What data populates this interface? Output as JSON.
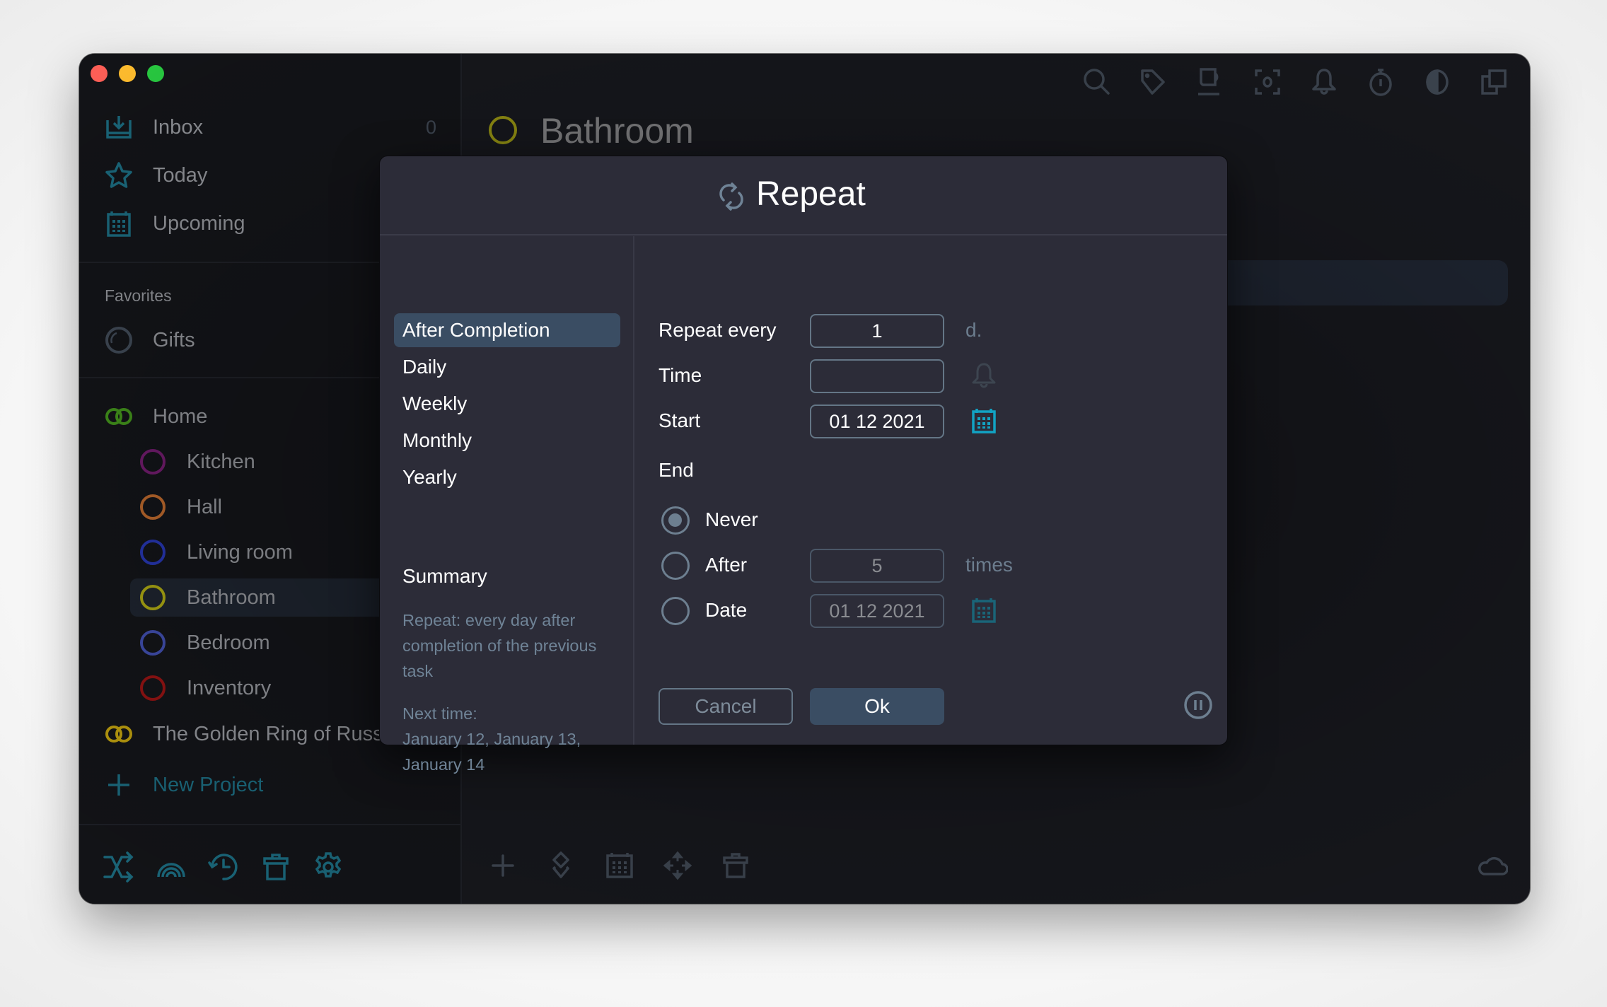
{
  "window": {
    "traffic_lights": [
      "close",
      "minimize",
      "zoom"
    ]
  },
  "sidebar": {
    "main_items": [
      {
        "label": "Inbox",
        "icon": "inbox-icon",
        "count": "0"
      },
      {
        "label": "Today",
        "icon": "star-icon"
      },
      {
        "label": "Upcoming",
        "icon": "calendar-icon"
      }
    ],
    "favorites_label": "Favorites",
    "favorites": [
      {
        "label": "Gifts",
        "icon": "progress-ring-icon",
        "color": "#3d4652"
      }
    ],
    "projects": [
      {
        "label": "Home",
        "icon": "linked-rings-icon",
        "color": "#3f8c1a"
      },
      {
        "label": "Kitchen",
        "color": "#6a1a66",
        "sub": true
      },
      {
        "label": "Hall",
        "color": "#b0622a",
        "sub": true
      },
      {
        "label": "Living room",
        "color": "#2433a6",
        "sub": true
      },
      {
        "label": "Bathroom",
        "color": "#a29e12",
        "sub": true,
        "selected": true
      },
      {
        "label": "Bedroom",
        "color": "#3d4aa4",
        "sub": true
      },
      {
        "label": "Inventory",
        "color": "#8c1212",
        "sub": true
      },
      {
        "label": "The Golden Ring of Russia",
        "icon": "linked-rings-icon",
        "color": "#b3960e"
      }
    ],
    "new_project_label": "New Project",
    "bottom_icons": [
      "shuffle-icon",
      "rainbow-icon",
      "history-icon",
      "trash-icon",
      "settings-icon"
    ]
  },
  "main": {
    "title": "Bathroom",
    "title_color": "#8e8b12",
    "toolbar_icons": [
      "search-icon",
      "tag-icon",
      "coffee-icon",
      "focus-icon",
      "bell-icon",
      "stopwatch-icon",
      "contrast-icon",
      "copy-icon"
    ],
    "bottom_icons": [
      "add-icon",
      "layers-icon",
      "calendar-icon",
      "move-icon",
      "trash-icon"
    ],
    "sync_icon": "cloud-icon"
  },
  "dialog": {
    "title": "Repeat",
    "options": [
      {
        "label": "After Completion",
        "selected": true
      },
      {
        "label": "Daily"
      },
      {
        "label": "Weekly"
      },
      {
        "label": "Monthly"
      },
      {
        "label": "Yearly"
      }
    ],
    "summary": {
      "title": "Summary",
      "lines": [
        "Repeat: every day after",
        "completion of the previous",
        "task"
      ],
      "next_lines": [
        "Next time:",
        "January 12, January 13,",
        "January 14"
      ]
    },
    "fields": {
      "repeat_every_label": "Repeat every",
      "repeat_every_value": "1",
      "repeat_every_unit": "d.",
      "time_label": "Time",
      "time_value": "",
      "start_label": "Start",
      "start_value": "01 12 2021",
      "end_label": "End"
    },
    "end_options": [
      {
        "label": "Never",
        "selected": true
      },
      {
        "label": "After",
        "value": "5",
        "unit": "times"
      },
      {
        "label": "Date",
        "value": "01 12 2021"
      }
    ],
    "cancel_label": "Cancel",
    "ok_label": "Ok",
    "accent": "#12a3c4"
  }
}
